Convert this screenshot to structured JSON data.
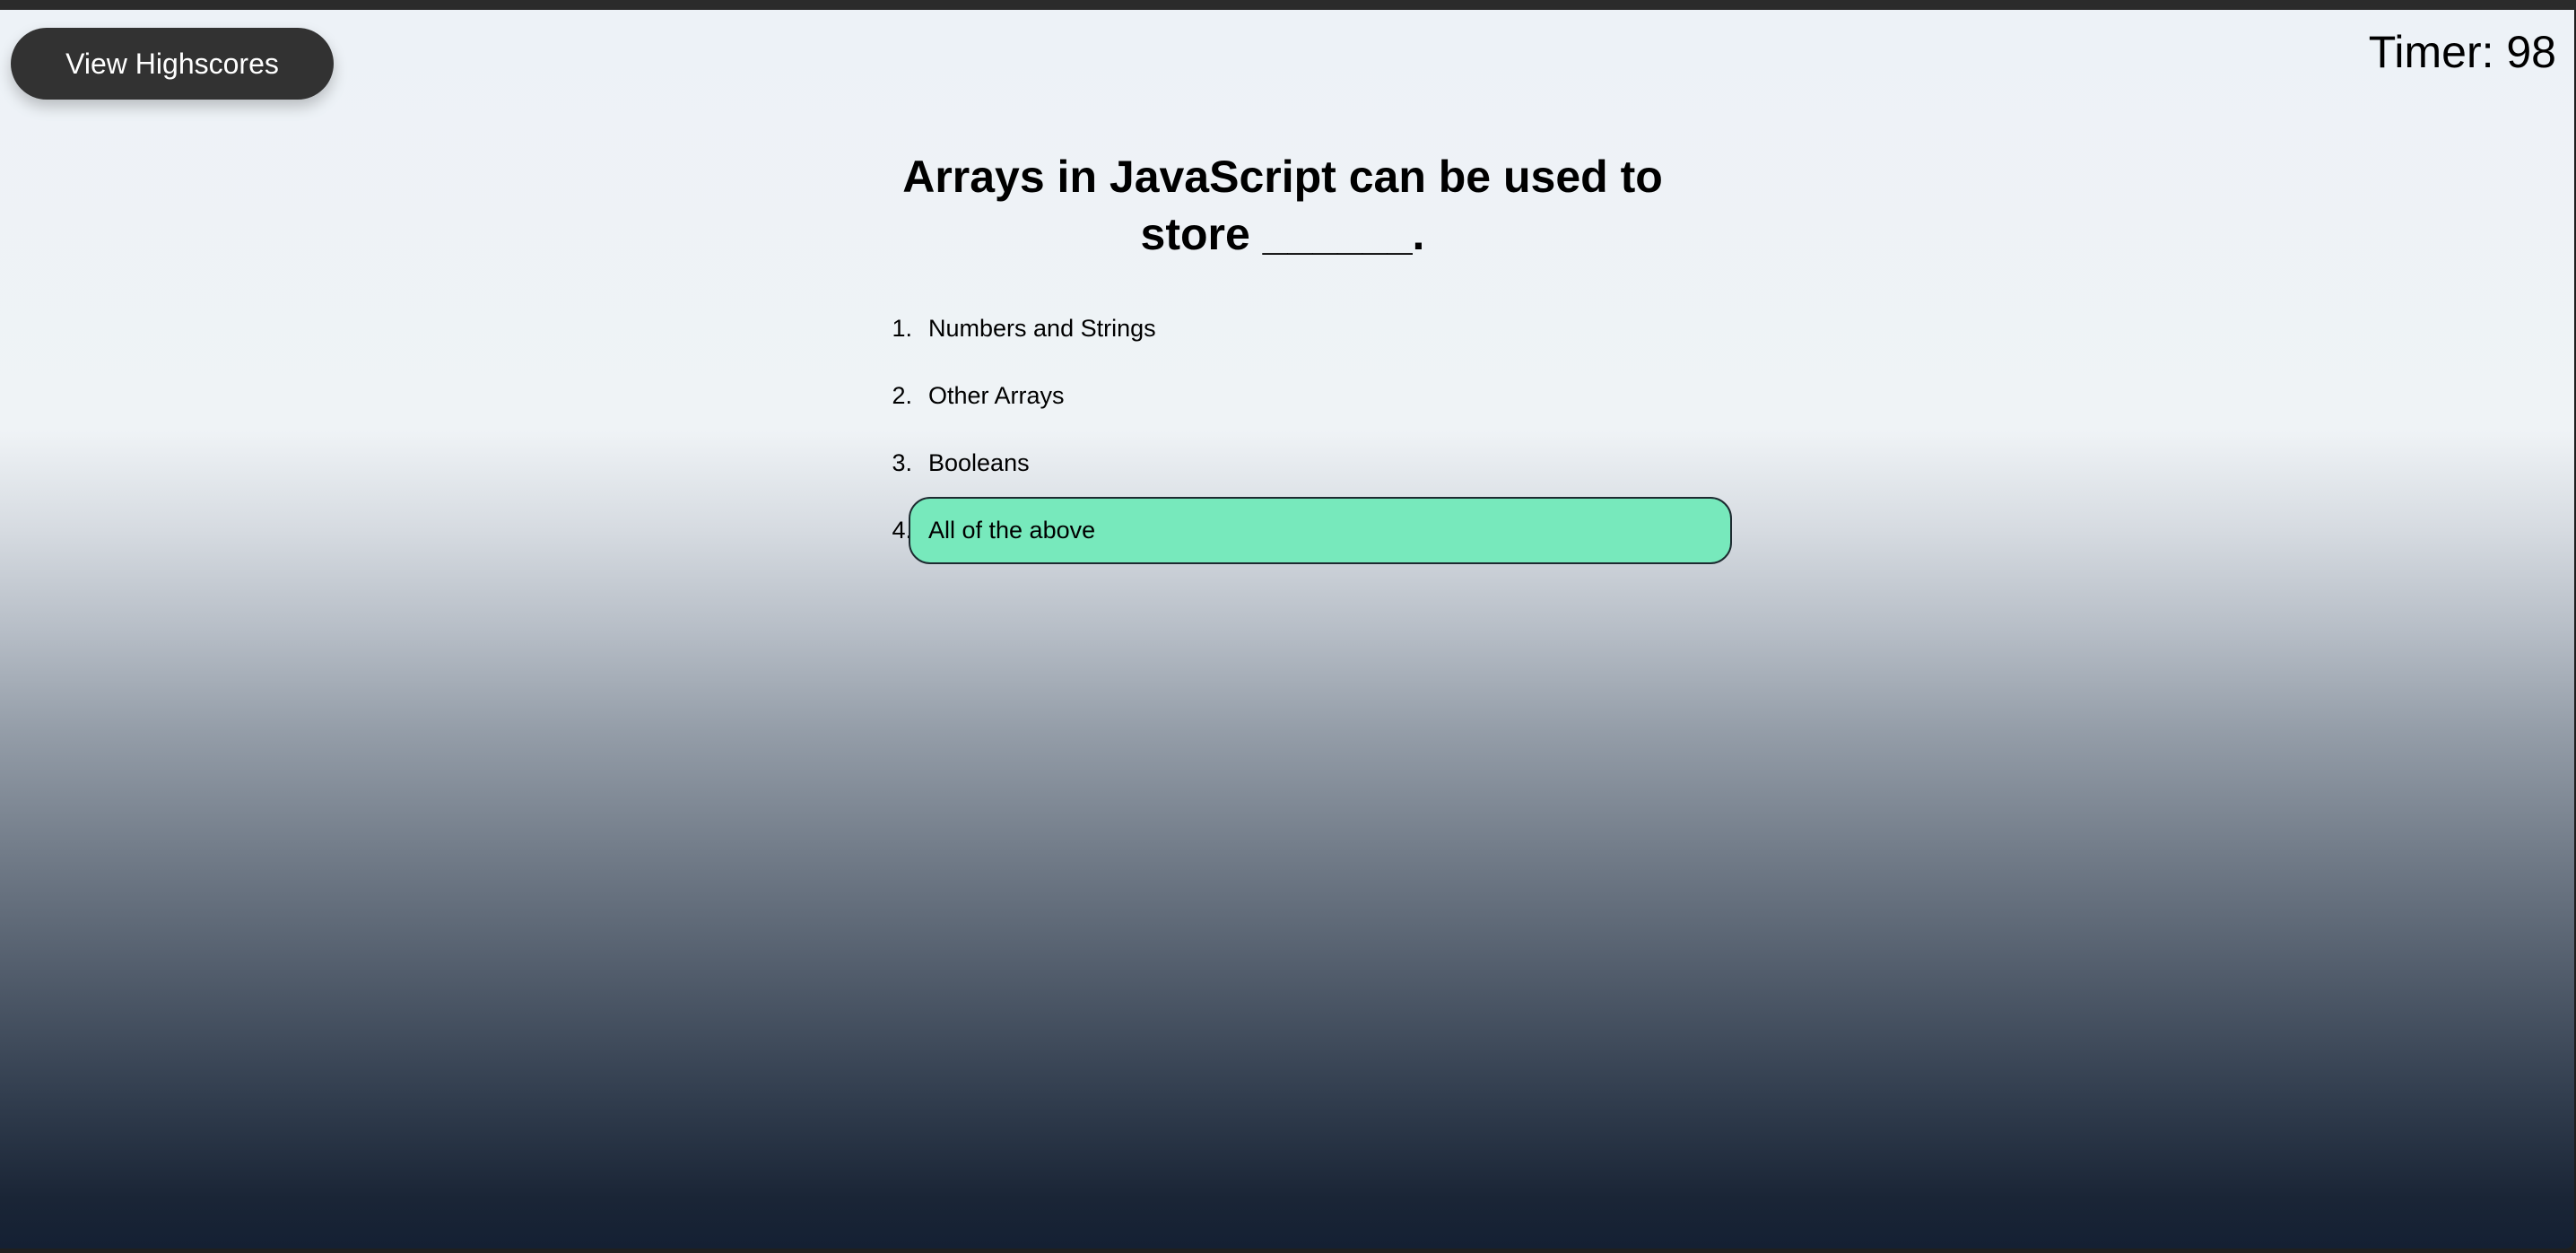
{
  "header": {
    "highscores_label": "View Highscores",
    "timer_text": "Timer: 98"
  },
  "quiz": {
    "question": "Arrays in JavaScript can be used to store ______.",
    "choices": [
      {
        "number": "1.",
        "label": "Numbers and Strings",
        "selected": false
      },
      {
        "number": "2.",
        "label": "Other Arrays",
        "selected": false
      },
      {
        "number": "3.",
        "label": "Booleans",
        "selected": false
      },
      {
        "number": "4.",
        "label": "All of the above",
        "selected": true
      }
    ]
  },
  "colors": {
    "button_bg": "#323232",
    "selected_choice_bg": "#77e9bc",
    "gradient_top": "#edf2f7",
    "gradient_bottom": "#142033"
  }
}
